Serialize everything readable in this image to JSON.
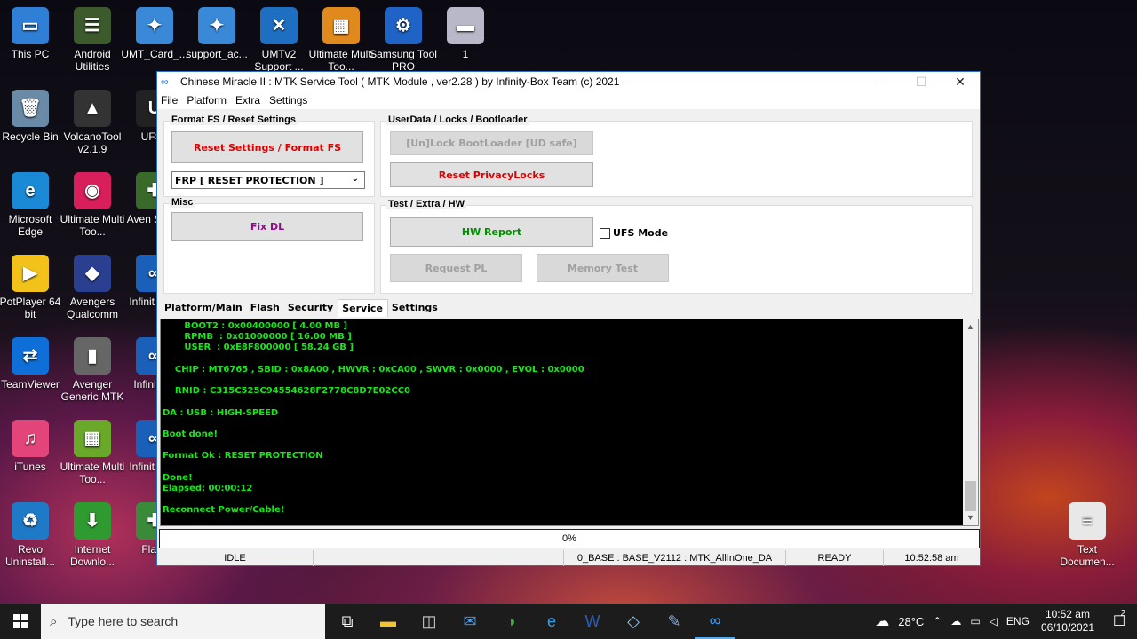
{
  "desktop": {
    "icons": [
      {
        "label": "This PC",
        "glyph": "▭",
        "color": "#2f7fd6"
      },
      {
        "label": "Android Utilities",
        "glyph": "☰",
        "color": "#3c5a2c"
      },
      {
        "label": "UMT_Card_...",
        "glyph": "✦",
        "color": "#3a88d8"
      },
      {
        "label": "support_ac...",
        "glyph": "✦",
        "color": "#3a88d8"
      },
      {
        "label": "UMTv2 Support ...",
        "glyph": "✕",
        "color": "#1e6ec2"
      },
      {
        "label": "Ultimate Multi Too...",
        "glyph": "▦",
        "color": "#e08a1e"
      },
      {
        "label": "Samsung Tool PRO",
        "glyph": "⚙",
        "color": "#1f63c6"
      },
      {
        "label": "1",
        "glyph": "▬",
        "color": "#b8b8c8"
      },
      {
        "label": "Recycle Bin",
        "glyph": "🗑",
        "color": "#6a8ba8"
      },
      {
        "label": "VolcanoTool v2.1.9",
        "glyph": "▲",
        "color": "#333333"
      },
      {
        "label": "UFS I",
        "glyph": "U",
        "color": "#222222"
      },
      {
        "label": "Microsoft Edge",
        "glyph": "e",
        "color": "#1a8ad6"
      },
      {
        "label": "Ultimate Multi Too...",
        "glyph": "◉",
        "color": "#d81e5b"
      },
      {
        "label": "Aven Sprea",
        "glyph": "✚",
        "color": "#3a6a2a"
      },
      {
        "label": "PotPlayer 64 bit",
        "glyph": "▶",
        "color": "#f2c21b"
      },
      {
        "label": "Avengers Qualcomm",
        "glyph": "◆",
        "color": "#2a3f8f"
      },
      {
        "label": "Infinit CM2",
        "glyph": "∞",
        "color": "#1a5fb8"
      },
      {
        "label": "TeamViewer",
        "glyph": "⇄",
        "color": "#0e6fd9"
      },
      {
        "label": "Avenger Generic MTK",
        "glyph": "▮",
        "color": "#666666"
      },
      {
        "label": "Infinit AS",
        "glyph": "∞",
        "color": "#1a5fb8"
      },
      {
        "label": "iTunes",
        "glyph": "♫",
        "color": "#e3457a"
      },
      {
        "label": "Ultimate Multi Too...",
        "glyph": "▦",
        "color": "#6aa829"
      },
      {
        "label": "Infinit CM2",
        "glyph": "∞",
        "color": "#1a5fb8"
      },
      {
        "label": "Revo Uninstall...",
        "glyph": "♻",
        "color": "#1e79c7"
      },
      {
        "label": "Internet Downlo...",
        "glyph": "⬇",
        "color": "#2f9a2f"
      },
      {
        "label": "Flash",
        "glyph": "✚",
        "color": "#3a8a3a"
      },
      {
        "label": "Text Documen...",
        "glyph": "≡",
        "color": "#e8e8e8"
      }
    ]
  },
  "window": {
    "title": "Chinese Miracle II : MTK Service Tool ( MTK Module , ver2.28 ) by Infinity-Box Team (c) 2021",
    "minimize": "—",
    "maximize": "☐",
    "close": "✕",
    "menu": [
      "File",
      "Platform",
      "Extra",
      "Settings"
    ],
    "groups": {
      "format": {
        "title": "Format FS / Reset Settings",
        "reset_btn": "Reset Settings / Format FS",
        "frp_select": "FRP [ RESET PROTECTION ]"
      },
      "userdata": {
        "title": "UserData /  Locks  / Bootloader",
        "unlock_btn": "[Un]Lock BootLoader [UD safe]",
        "privacy_btn": "Reset PrivacyLocks"
      },
      "misc": {
        "title": "Misc",
        "fixdl_btn": "Fix DL"
      },
      "test": {
        "title": "Test / Extra / HW",
        "hwreport_btn": "HW Report",
        "ufs_label": "UFS Mode",
        "ufs_checked": false,
        "requestpl_btn": "Request PL",
        "memtest_btn": "Memory Test"
      }
    },
    "tabs": [
      "Platform/Main",
      "Flash",
      "Security",
      "Service",
      "Settings"
    ],
    "active_tab": "Service",
    "log": [
      "       BOOT2 : 0x00400000 [ 4.00 MB ]",
      "       RPMB  : 0x01000000 [ 16.00 MB ]",
      "       USER  : 0xE8F800000 [ 58.24 GB ]",
      "",
      "    CHIP : MT6765 , SBID : 0x8A00 , HWVR : 0xCA00 , SWVR : 0x0000 , EVOL : 0x0000",
      "",
      "    RNID : C315C525C94554628F2778C8D7E02CC0",
      "",
      "DA : USB : HIGH-SPEED",
      "",
      "Boot done!",
      "",
      "Format Ok : RESET PROTECTION",
      "",
      "Done!",
      "Elapsed: 00:00:12",
      "",
      "Reconnect Power/Cable!"
    ],
    "progress": "0%",
    "progress_value": 0,
    "status": {
      "state": "IDLE",
      "base": "0_BASE : BASE_V2112 : MTK_AllInOne_DA",
      "ready": "READY",
      "time": "10:52:58 am"
    }
  },
  "taskbar": {
    "search_placeholder": "Type here to search",
    "weather": "28°C",
    "lang": "ENG",
    "clock_time": "10:52 am",
    "clock_date": "06/10/2021",
    "notifications": "2"
  }
}
